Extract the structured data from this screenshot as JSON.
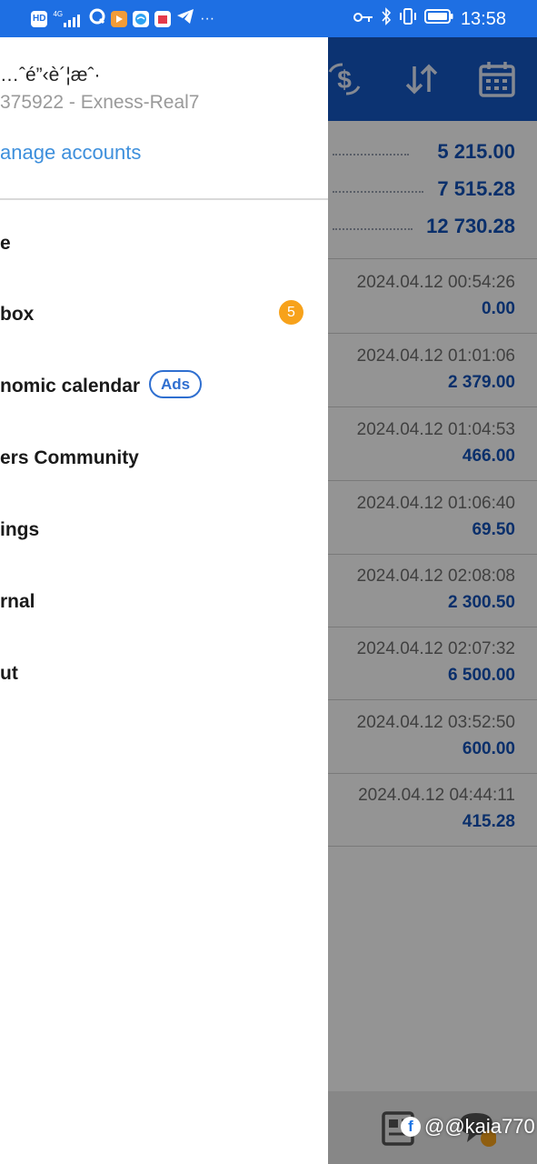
{
  "status_bar": {
    "time": "13:58",
    "network": "4G",
    "hd": "HD",
    "icons": [
      "hd-icon",
      "signal-icon",
      "q-app-icon",
      "video-app-icon",
      "browser-app-icon",
      "calendar-app-icon",
      "telegram-icon",
      "more-dots-icon",
      "key-icon",
      "bluetooth-icon",
      "vibrate-icon",
      "battery-icon"
    ],
    "more": "···"
  },
  "app": {
    "header_icons": [
      "currency-exchange-icon",
      "sort-icon",
      "calendar-icon"
    ],
    "totals": [
      "5 215.00",
      "7 515.28",
      "12 730.28"
    ],
    "deals": [
      {
        "time": "2024.04.12 00:54:26",
        "amount": "0.00"
      },
      {
        "time": "2024.04.12 01:01:06",
        "amount": "2 379.00"
      },
      {
        "time": "2024.04.12 01:04:53",
        "amount": "466.00"
      },
      {
        "time": "2024.04.12 01:06:40",
        "amount": "69.50"
      },
      {
        "time": "2024.04.12 02:08:08",
        "amount": "2 300.50"
      },
      {
        "time": "2024.04.12 02:07:32",
        "amount": "6 500.00"
      },
      {
        "time": "2024.04.12 03:52:50",
        "amount": "600.00"
      },
      {
        "time": "2024.04.12 04:44:11",
        "amount": "415.28"
      }
    ]
  },
  "drawer": {
    "account_name": "…ˆé”‹è´¦æˆ·",
    "account_id": "375922 - Exness-Real7",
    "manage_accounts": "anage accounts",
    "menu": [
      {
        "label": "e"
      },
      {
        "label": "box",
        "badge": "5"
      },
      {
        "label": "nomic calendar",
        "tag": "Ads"
      },
      {
        "label": "ers Community"
      },
      {
        "label": "ings"
      },
      {
        "label": "rnal"
      },
      {
        "label": "ut"
      }
    ]
  },
  "watermark": {
    "text": "@@kaia770",
    "icon": "facebook-icon"
  },
  "colors": {
    "status_bar": "#1e6fe3",
    "app_header": "#1558c5",
    "amount_blue": "#1252b8",
    "link_blue": "#3d8fdc",
    "badge_orange": "#f7a21b"
  }
}
